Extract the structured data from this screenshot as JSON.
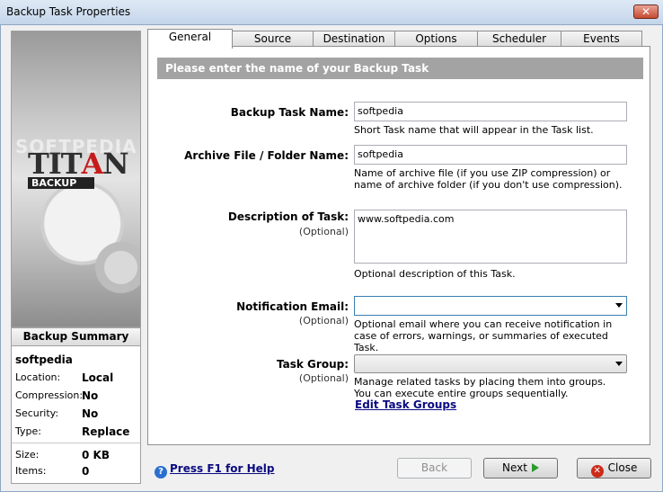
{
  "window": {
    "title": "Backup Task Properties",
    "close_glyph": "✕"
  },
  "logo": {
    "watermark": "SOFTPEDIA",
    "titan_a": "TIT",
    "titan_b": "A",
    "titan_c": "N",
    "backup": "BACKUP"
  },
  "summary": {
    "header": "Backup Summary",
    "task_name": "softpedia",
    "rows": [
      {
        "key": "Location:",
        "value": "Local"
      },
      {
        "key": "Compression:",
        "value": "No"
      },
      {
        "key": "Security:",
        "value": "No"
      },
      {
        "key": "Type:",
        "value": "Replace"
      },
      {
        "key": "Size:",
        "value": "0 KB"
      },
      {
        "key": "Items:",
        "value": "0"
      }
    ]
  },
  "tabs": [
    "General",
    "Source",
    "Destination",
    "Options",
    "Scheduler",
    "Events"
  ],
  "active_tab": "General",
  "panel": {
    "banner": "Please enter the name of your Backup Task",
    "task_name": {
      "label": "Backup Task Name:",
      "value": "softpedia",
      "help": "Short Task name that will appear in the Task list."
    },
    "archive": {
      "label": "Archive File / Folder Name:",
      "value": "softpedia",
      "help": "Name of archive file (if you use ZIP compression) or name of archive folder (if you don't use compression)."
    },
    "description": {
      "label": "Description of Task:",
      "optional": "(Optional)",
      "value": "www.softpedia.com",
      "help": "Optional description of this Task."
    },
    "email": {
      "label": "Notification Email:",
      "optional": "(Optional)",
      "value": "",
      "help": "Optional email where you can receive notification in case of errors, warnings, or summaries of executed Task."
    },
    "group": {
      "label": "Task Group:",
      "optional": "(Optional)",
      "value": "",
      "help": "Manage related tasks by placing them into groups. You can execute entire groups sequentially.",
      "link": "Edit Task Groups"
    }
  },
  "footer": {
    "help_link": "Press F1 for Help",
    "back": "Back",
    "next": "Next",
    "close": "Close"
  }
}
